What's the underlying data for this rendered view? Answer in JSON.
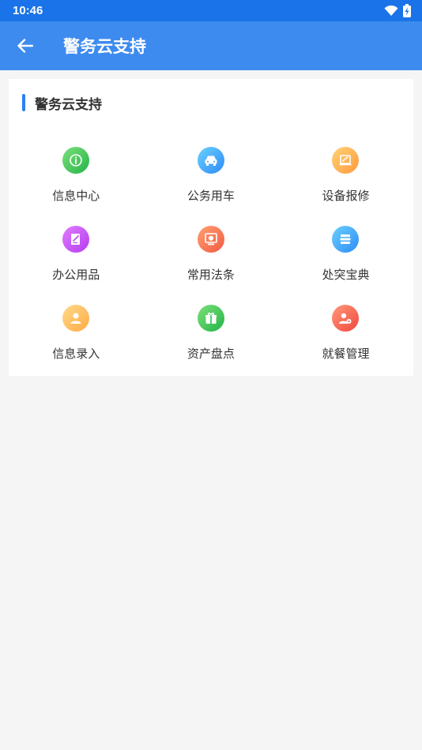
{
  "status_bar": {
    "time": "10:46"
  },
  "app_bar": {
    "title": "警务云支持"
  },
  "card": {
    "title": "警务云支持",
    "items": [
      {
        "label": "信息中心",
        "icon": "info-icon",
        "color": "#2fbf55"
      },
      {
        "label": "公务用车",
        "icon": "car-icon",
        "color": "#3a9af6"
      },
      {
        "label": "设备报修",
        "icon": "repair-icon",
        "color": "#ffad4a"
      },
      {
        "label": "办公用品",
        "icon": "document-edit-icon",
        "color": "#c24ef5"
      },
      {
        "label": "常用法条",
        "icon": "law-icon",
        "color": "#f46b4e"
      },
      {
        "label": "处突宝典",
        "icon": "book-stack-icon",
        "color": "#3a9af6"
      },
      {
        "label": "信息录入",
        "icon": "user-icon",
        "color": "#ffb24f"
      },
      {
        "label": "资产盘点",
        "icon": "gift-box-icon",
        "color": "#2fbf55"
      },
      {
        "label": "就餐管理",
        "icon": "user-settings-icon",
        "color": "#f2564a"
      }
    ]
  }
}
